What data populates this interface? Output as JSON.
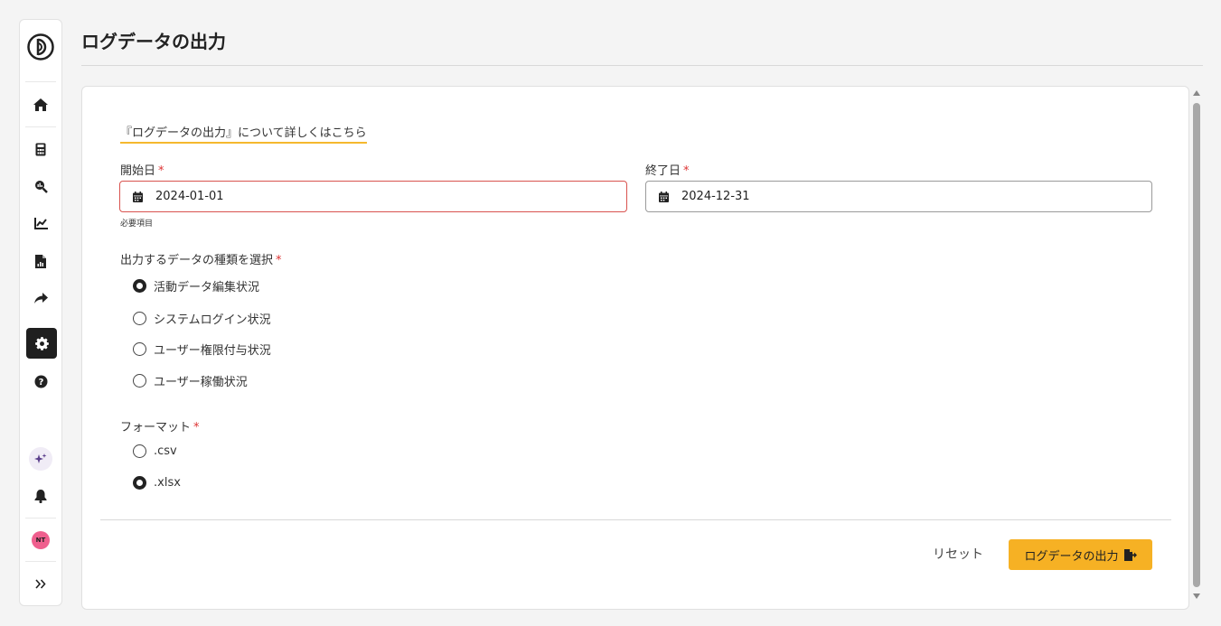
{
  "page": {
    "title": "ログデータの出力"
  },
  "sidebar": {
    "items": [
      {
        "icon": "app-logo-icon"
      },
      {
        "icon": "home-icon"
      },
      {
        "icon": "calculator-icon"
      },
      {
        "icon": "search-analytics-icon"
      },
      {
        "icon": "line-chart-icon"
      },
      {
        "icon": "report-document-icon"
      },
      {
        "icon": "share-arrow-icon"
      },
      {
        "icon": "gear-icon",
        "active": true
      },
      {
        "icon": "help-icon"
      },
      {
        "icon": "ai-sparkle-icon"
      },
      {
        "icon": "bell-icon"
      },
      {
        "icon": "avatar"
      },
      {
        "icon": "double-chevron-right-icon"
      }
    ],
    "avatar_initials": "NT",
    "active_color": "#1f1f1f"
  },
  "form": {
    "help_link": "『ログデータの出力』について詳しくはこちら",
    "required_mark": "*",
    "start_date": {
      "label": "開始日",
      "value": "2024-01-01",
      "error": "必要項目"
    },
    "end_date": {
      "label": "終了日",
      "value": "2024-12-31"
    },
    "data_type": {
      "label": "出力するデータの種類を選択",
      "options": [
        {
          "label": "活動データ編集状況",
          "checked": true
        },
        {
          "label": "システムログイン状況",
          "checked": false
        },
        {
          "label": "ユーザー権限付与状況",
          "checked": false
        },
        {
          "label": "ユーザー稼働状況",
          "checked": false
        }
      ]
    },
    "format": {
      "label": "フォーマット",
      "options": [
        {
          "label": ".csv",
          "checked": false
        },
        {
          "label": ".xlsx",
          "checked": true
        }
      ]
    }
  },
  "actions": {
    "reset_label": "リセット",
    "export_label": "ログデータの出力",
    "export_color": "#f6b124"
  }
}
